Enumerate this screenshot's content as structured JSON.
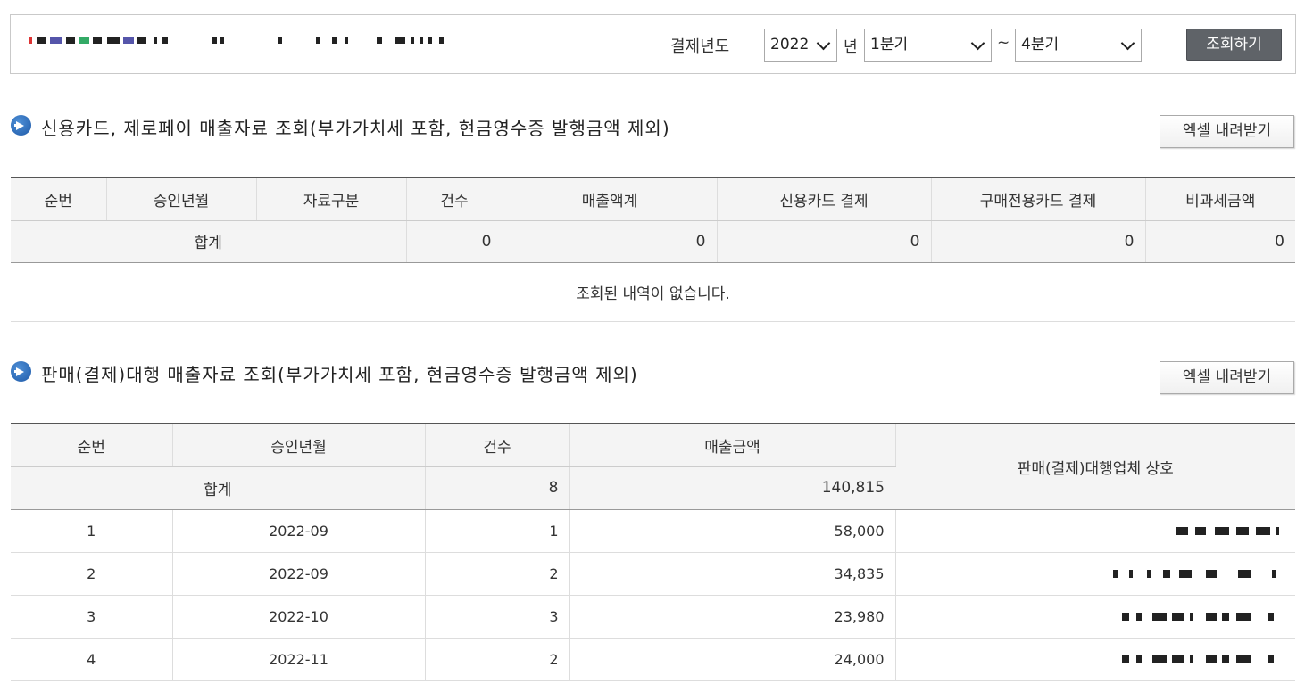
{
  "search": {
    "period_label": "결제년도",
    "year_value": "2022",
    "year_suffix": "년",
    "from_quarter": "1분기",
    "range_sep": "~",
    "to_quarter": "4분기",
    "submit_label": "조회하기"
  },
  "section1": {
    "title": "신용카드, 제로페이 매출자료 조회(부가가치세 포함, 현금영수증 발행금액 제외)",
    "excel_label": "엑셀 내려받기",
    "columns": [
      "순번",
      "승인년월",
      "자료구분",
      "건수",
      "매출액계",
      "신용카드 결제",
      "구매전용카드 결제",
      "비과세금액"
    ],
    "total": {
      "label": "합계",
      "count": "0",
      "sales_total": "0",
      "credit_card": "0",
      "purchase_card": "0",
      "tax_exempt": "0"
    },
    "empty_message": "조회된 내역이 없습니다."
  },
  "section2": {
    "title": "판매(결제)대행 매출자료 조회(부가가치세 포함, 현금영수증 발행금액 제외)",
    "excel_label": "엑셀 내려받기",
    "columns": [
      "순번",
      "승인년월",
      "건수",
      "매출금액",
      "판매(결제)대행업체 상호"
    ],
    "total": {
      "label": "합계",
      "count": "8",
      "amount": "140,815"
    },
    "rows": [
      {
        "no": "1",
        "month": "2022-09",
        "count": "1",
        "amount": "58,000"
      },
      {
        "no": "2",
        "month": "2022-09",
        "count": "2",
        "amount": "34,835"
      },
      {
        "no": "3",
        "month": "2022-10",
        "count": "3",
        "amount": "23,980"
      },
      {
        "no": "4",
        "month": "2022-11",
        "count": "2",
        "amount": "24,000"
      }
    ]
  }
}
